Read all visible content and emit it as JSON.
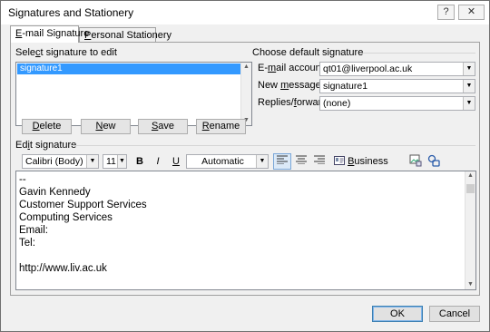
{
  "window": {
    "title": "Signatures and Stationery",
    "help_glyph": "?",
    "close_glyph": "✕"
  },
  "tabs": [
    {
      "label": "E-mail Signature",
      "mnemonic": "E",
      "rest": "-mail Signature"
    },
    {
      "label": "Personal Stationery",
      "mnemonic": "P",
      "rest": "ersonal Stationery"
    }
  ],
  "select_signature": {
    "label_pre": "Sele",
    "label_mn": "c",
    "label_post": "t signature to edit",
    "items": [
      "signature1"
    ],
    "selected": "signature1"
  },
  "actions": {
    "delete": {
      "mn": "D",
      "rest": "elete"
    },
    "new": {
      "mn": "N",
      "rest": "ew"
    },
    "save": {
      "mn": "S",
      "rest": "ave"
    },
    "rename": {
      "mn": "R",
      "rest": "ename"
    }
  },
  "default_signature": {
    "heading": "Choose default signature",
    "email_label_pre": "E-",
    "email_label_mn": "m",
    "email_label_post": "ail account:",
    "email_value": "qt01@liverpool.ac.uk",
    "new_label_pre": "New ",
    "new_label_mn": "m",
    "new_label_post": "essages:",
    "new_value": "signature1",
    "replies_label_pre": "Replies/",
    "replies_label_mn": "f",
    "replies_label_post": "orwards:",
    "replies_value": "(none)"
  },
  "edit_signature": {
    "label_pre": "Ed",
    "label_mn": "i",
    "label_post": "t signature",
    "font_family": "Calibri (Body)",
    "font_size": "11",
    "bold": "B",
    "italic": "I",
    "underline": "U",
    "color": "Automatic",
    "business_card_pre": "",
    "business_card_mn": "B",
    "business_card_post": "usiness Card",
    "lines": [
      "--",
      "Gavin Kennedy",
      "Customer Support Services",
      "Computing Services",
      "Email:",
      "Tel:",
      "",
      "http://www.liv.ac.uk"
    ]
  },
  "footer": {
    "ok": "OK",
    "cancel": "Cancel"
  },
  "colors": {
    "selection": "#3399ff",
    "default_button_border": "#3c7fb1"
  }
}
